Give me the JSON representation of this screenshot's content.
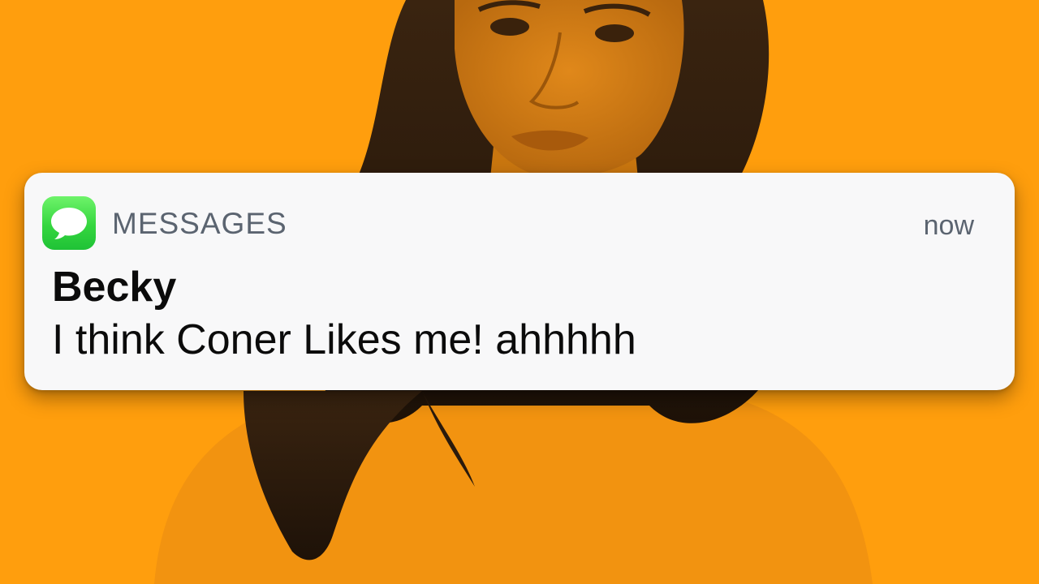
{
  "colors": {
    "background": "#ff9e0d",
    "card": "#f8f8f9",
    "app_icon_green": "#35d63f",
    "muted_text": "#5b6470",
    "primary_text": "#0b0b0b"
  },
  "background_image": {
    "icon": "portrait-photo"
  },
  "notification": {
    "app_icon": "messages-bubble-icon",
    "app_name": "MESSAGES",
    "timestamp": "now",
    "sender": "Becky",
    "message": "I think Coner Likes me! ahhhhh"
  }
}
